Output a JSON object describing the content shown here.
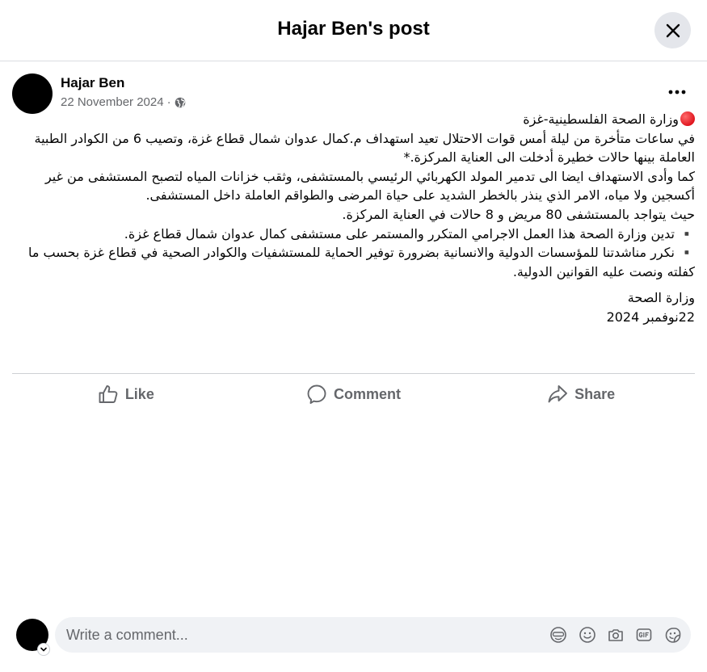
{
  "header": {
    "title": "Hajar Ben's post"
  },
  "post": {
    "author": "Hajar Ben",
    "date": "22 November 2024",
    "meta_separator": "·",
    "privacy_icon": "globe-icon",
    "lines": [
      "وزارة الصحة الفلسطينية-غزة",
      "في ساعات متأخرة من ليلة أمس قوات الاحتلال تعيد استهداف م.كمال عدوان شمال قطاع غزة، وتصيب 6  من الكوادر الطبية العاملة بينها حالات خطيرة أدخلت الى العناية المركزة.*",
      "كما وأدى الاستهداف ايضا الى تدمير المولد الكهربائي الرئيسي  بالمستشفى، وثقب خزانات المياه لتصبح المستشفى من غير أكسجين ولا مياه، الامر الذي ينذر بالخطر الشديد على حياة المرضى والطواقم العاملة داخل المستشفى.",
      "حيث يتواجد بالمستشفى 80 مريض و 8 حالات في العناية المركزة.",
      "▪️ تدين وزارة الصحة هذا العمل الاجرامي المتكرر والمستمر  على مستشفى كمال عدوان شمال قطاع غزة.",
      "▪️ نكرر مناشدتنا للمؤسسات الدولية والانسانية بضرورة توفير الحماية للمستشفيات والكوادر الصحية في قطاع غزة بحسب ما كفلته ونصت عليه القوانين الدولية.",
      "وزارة الصحة",
      "22نوفمبر 2024"
    ]
  },
  "actions": {
    "like": "Like",
    "comment": "Comment",
    "share": "Share"
  },
  "comment_box": {
    "placeholder": "Write a comment...",
    "icons": [
      "avatar-sticker-icon",
      "emoji-icon",
      "camera-icon",
      "gif-icon",
      "sticker-icon"
    ]
  },
  "colors": {
    "secondary_text": "#65676b",
    "comment_bg": "#f0f2f5",
    "close_bg": "#e4e6eb",
    "red_dot": "#e0161f"
  }
}
